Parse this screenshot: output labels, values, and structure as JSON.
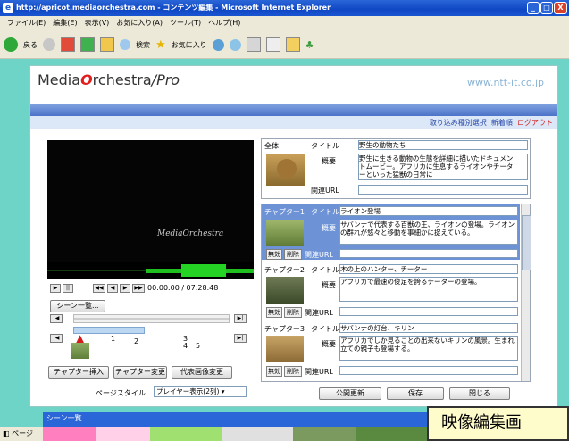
{
  "window": {
    "title": "http://apricot.mediaorchestra.com - コンテンツ編集 - Microsoft Internet Explorer",
    "min": "_",
    "max": "□",
    "close": "X"
  },
  "menu": [
    "ファイル(E)",
    "編集(E)",
    "表示(V)",
    "お気に入り(A)",
    "ツール(T)",
    "ヘルプ(H)"
  ],
  "toolbar": {
    "back": "戻る",
    "search": "検索",
    "favorites": "お気に入り"
  },
  "header": {
    "logo_a": "Media",
    "logo_o": "O",
    "logo_b": "rchestra",
    "logo_c": "/Pro",
    "site": "www.ntt-it.co.jp",
    "link_type": "取り込み種別選択",
    "link_new": "新着順",
    "link_logout": "ログアウト"
  },
  "player": {
    "watermark": "MediaOrchestra",
    "time": "00:00.00 / 07:28.48",
    "scene_list_btn": "シーン一覧...",
    "marks": [
      "1",
      "2",
      "3",
      "4",
      "5"
    ]
  },
  "buttons": {
    "insert_chapter": "チャプター挿入",
    "change_chapter": "チャプター変更",
    "change_thumb": "代表画像変更",
    "publish": "公開更新",
    "save": "保存",
    "close": "閉じる",
    "disable": "無効",
    "delete": "削除"
  },
  "page_style": {
    "label": "ページスタイル",
    "value": "プレイヤー表示(2列)"
  },
  "labels": {
    "title": "タイトル",
    "summary": "概要",
    "related": "関連URL"
  },
  "overall": {
    "heading": "全体",
    "title": "野生の動物たち",
    "summary": "野生に生きる動物の生態を詳細に描いたドキュメントムービー。アフリカに生息するライオンやチーターといった猛獣の日常に"
  },
  "chapters": [
    {
      "heading": "チャプター1",
      "title": "ライオン登場",
      "summary": "サバンナで代表する百獣の王、ライオンの登場。ライオンの群れが悠々と移動を事細かに捉えている。"
    },
    {
      "heading": "チャプター2",
      "title": "木の上のハンター、チーター",
      "summary": "アフリカで最速の俊足を誇るチーターの登場。"
    },
    {
      "heading": "チャプター3",
      "title": "サバンナの灯台、キリン",
      "summary": "アフリカでしか見ることの出来ないキリンの風景。生まれ立ての親子も登場する。"
    }
  ],
  "status": {
    "text": "ページ"
  },
  "popup": {
    "title": "シーン一覧"
  },
  "annotation": {
    "text": "映像編集画"
  },
  "colors": {
    "accent": "#2446a8",
    "logout": "#d41c1c",
    "chapter_head": "#6d93d6",
    "background": "#6fd4c8"
  }
}
